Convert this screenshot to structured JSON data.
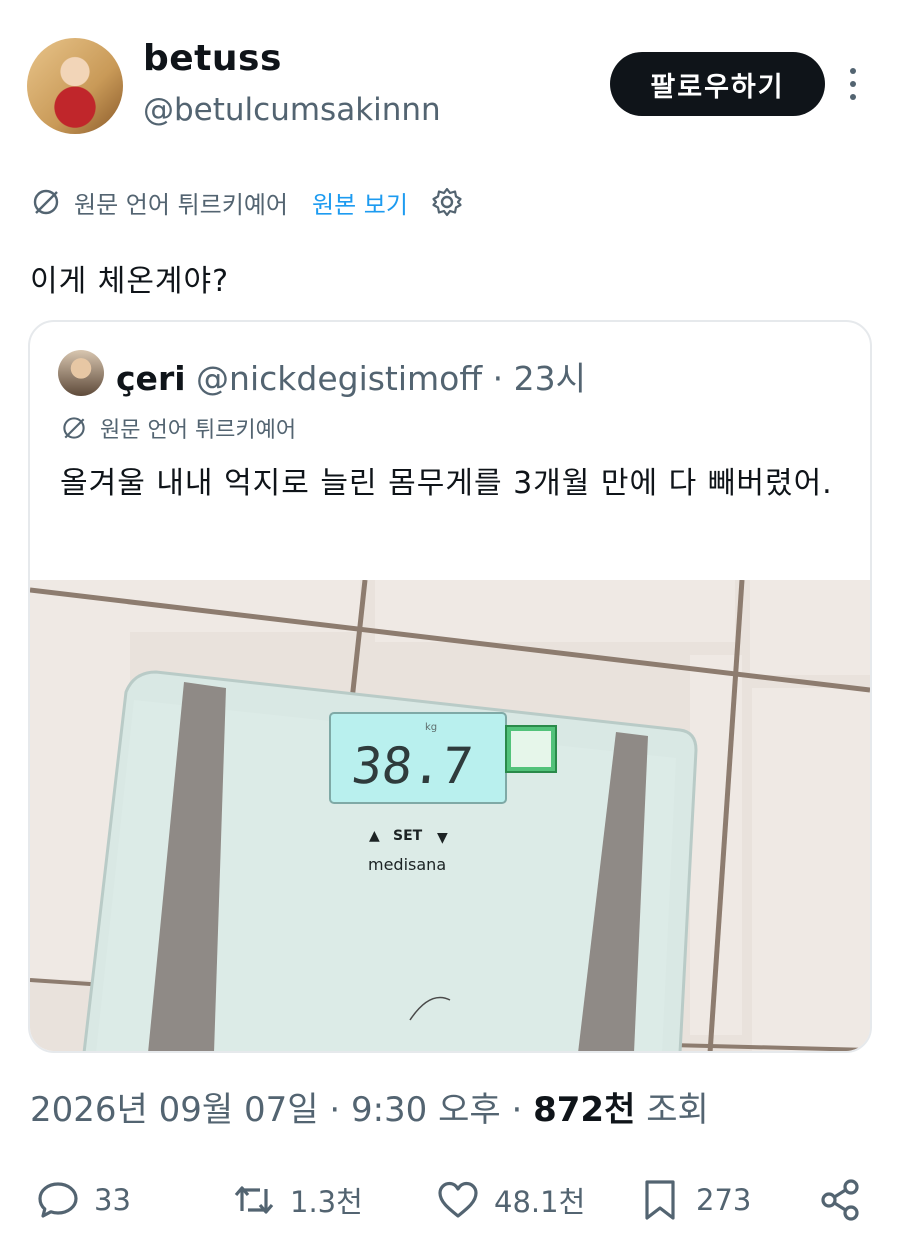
{
  "author": {
    "display_name": "betuss",
    "handle": "@betulcumsakinnn",
    "follow_label": "팔로우하기"
  },
  "translation": {
    "language_note": "원문 언어 튀르키예어",
    "view_original": "원본 보기"
  },
  "tweet_text": "이게 체온계야?",
  "quote": {
    "name": "çeri",
    "handle": "@nickdegistimoff",
    "separator": "·",
    "time": "23시",
    "language_note": "원문 언어 튀르키예어",
    "text": "올겨울 내내 억지로 늘린 몸무게를 3개월 만에 다 빼버렸어.",
    "image": {
      "scale_unit": "kg",
      "scale_reading": "38.7",
      "scale_button_label": "SET",
      "scale_brand": "medisana"
    }
  },
  "meta": {
    "date": "2026년 09월 07일",
    "sep1": "·",
    "time": "9:30 오후",
    "sep2": "·",
    "views_count": "872천",
    "views_label": "조회"
  },
  "actions": {
    "replies": "33",
    "reposts": "1.3천",
    "likes": "48.1천",
    "bookmarks": "273"
  },
  "colors": {
    "text": "#0f1419",
    "secondary": "#536471",
    "accent": "#1d9bf0",
    "follow_bg": "#0f1419"
  }
}
